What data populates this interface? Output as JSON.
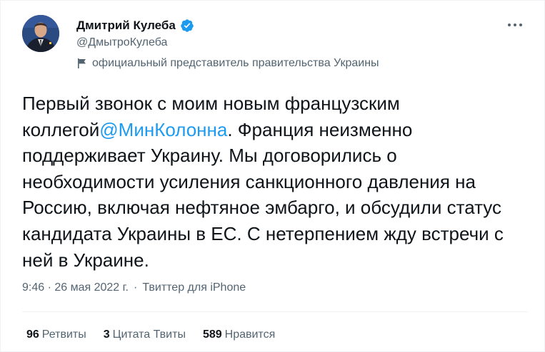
{
  "author": {
    "display_name": "Дмитрий Кулеба",
    "handle": "@ДмытроКулеба",
    "label": "официальный представитель правительства Украины"
  },
  "icons": {
    "verified": "verified-badge-icon",
    "flag": "flag-icon",
    "more": "more-options-icon"
  },
  "tweet": {
    "text_before": "Первый звонок с моим новым французским коллегой",
    "mention": "@МинКолонна",
    "text_after": ". Франция неизменно поддерживает Украину. Мы договорились о необходимости усиления санкционного давления на Россию, включая нефтяное эмбарго, и обсудили статус кандидата Украины в ЕС. С нетерпением жду встречи с ней в Украине."
  },
  "meta": {
    "timestamp": "9:46 · 26 мая 2022 г.",
    "separator": "·",
    "source": "Твиттер для iPhone"
  },
  "stats": [
    {
      "count": "96",
      "label": "Ретвиты"
    },
    {
      "count": "3",
      "label": "Цитата Твиты"
    },
    {
      "count": "589",
      "label": "Нравится"
    }
  ],
  "colors": {
    "accent": "#1d9bf0",
    "text": "#0f1419",
    "secondary": "#536471",
    "divider": "#eff3f4"
  }
}
